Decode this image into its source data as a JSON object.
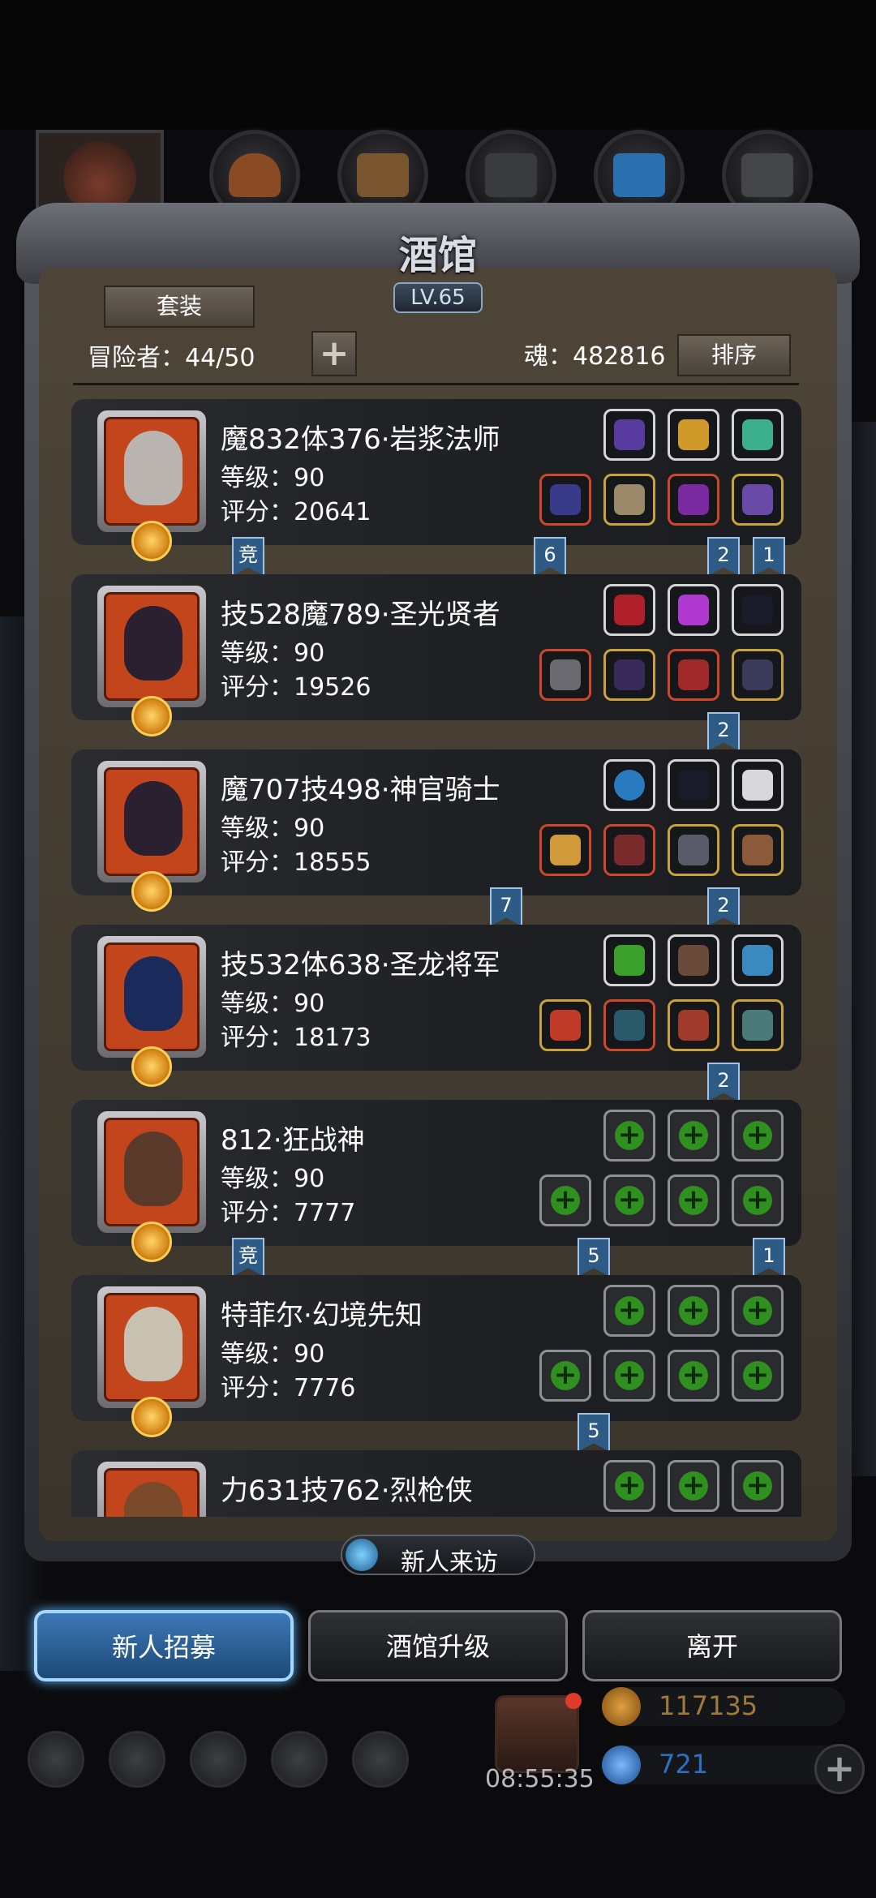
{
  "header": {
    "title": "酒馆",
    "level": "LV.65"
  },
  "toolbar": {
    "set_label": "套装",
    "adventurers": "冒险者：44/50",
    "add_label": "+",
    "soul": "魂：482816",
    "sort_label": "排序"
  },
  "heroes": [
    {
      "name": "魔832体376·岩浆法师",
      "level": "等级：90",
      "score": "评分：20641",
      "ribbons": [
        "竞",
        "6",
        "2",
        "1"
      ]
    },
    {
      "name": "技528魔789·圣光贤者",
      "level": "等级：90",
      "score": "评分：19526",
      "ribbons": [
        "2"
      ]
    },
    {
      "name": "魔707技498·神官骑士",
      "level": "等级：90",
      "score": "评分：18555",
      "ribbons": [
        "7",
        "2"
      ]
    },
    {
      "name": "技532体638·圣龙将军",
      "level": "等级：90",
      "score": "评分：18173",
      "ribbons": [
        "2"
      ]
    },
    {
      "name": "812·狂战神",
      "level": "等级：90",
      "score": "评分：7777",
      "ribbons": [
        "竞",
        "5",
        "1"
      ]
    },
    {
      "name": "特菲尔·幻境先知",
      "level": "等级：90",
      "score": "评分：7776",
      "ribbons": [
        "5"
      ]
    },
    {
      "name": "力631技762·烈枪侠",
      "level": "",
      "score": "",
      "ribbons": []
    }
  ],
  "visit_label": "新人来访",
  "actions": {
    "recruit": "新人招募",
    "upgrade": "酒馆升级",
    "leave": "离开"
  },
  "status": {
    "timer": "08:55:35",
    "gold": "117135",
    "gems": "721"
  },
  "colors": {
    "accent_blue": "#3c78b6",
    "panel": "#4e4538",
    "gold_text": "#a07a3a",
    "gem_text": "#2f6fc0"
  }
}
